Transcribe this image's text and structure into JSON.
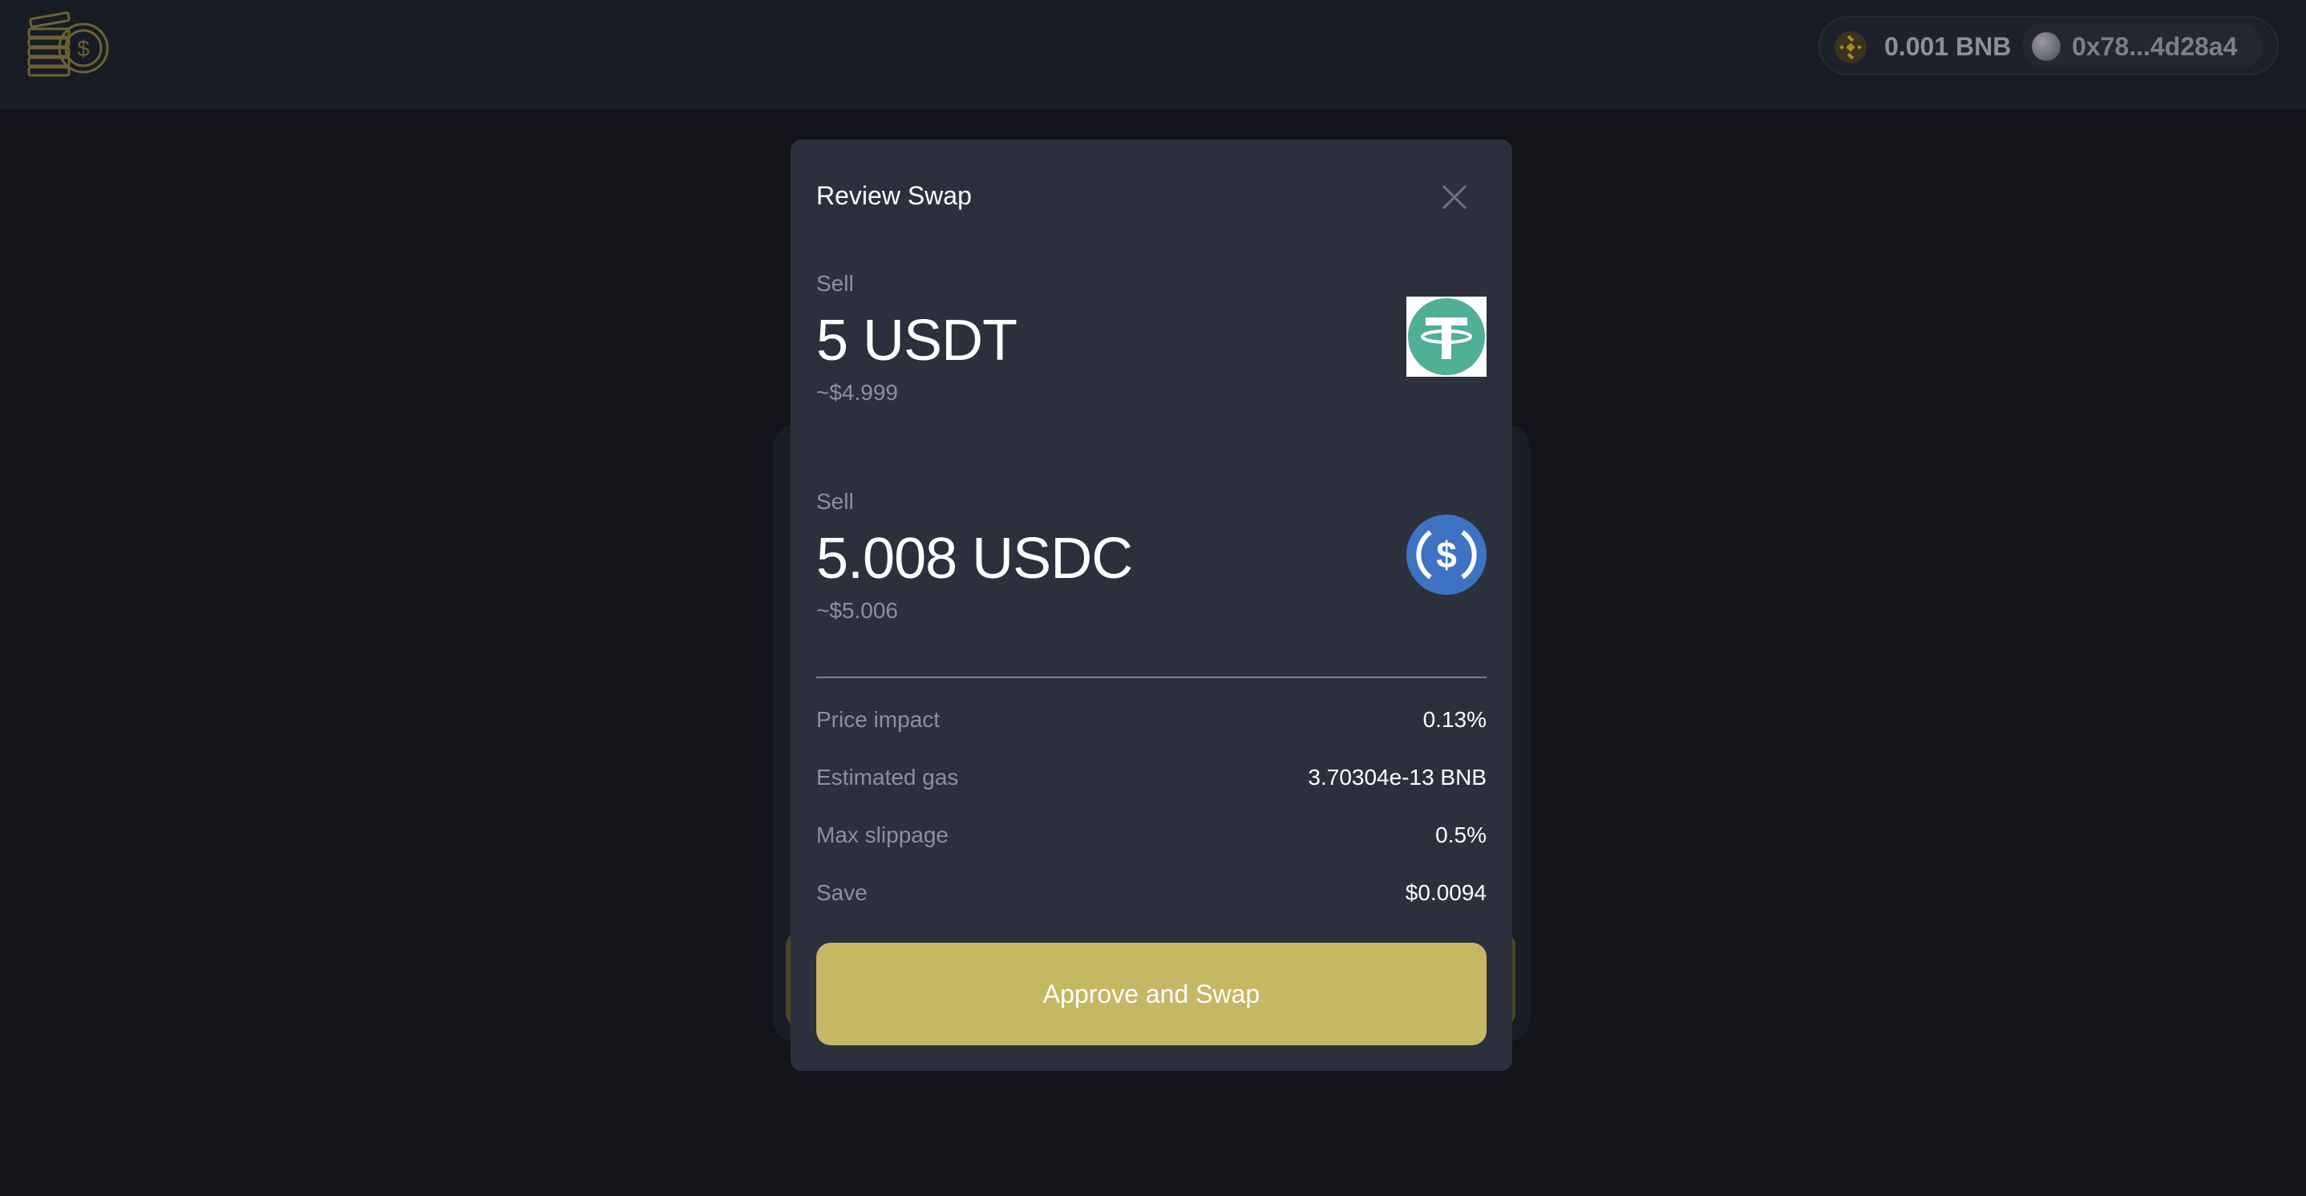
{
  "header": {
    "bnb_balance": "0.001 BNB",
    "wallet_address": "0x78...4d28a4"
  },
  "modal": {
    "title": "Review Swap",
    "sell": {
      "label": "Sell",
      "amount": "5 USDT",
      "usd": "~$4.999",
      "token_icon": "usdt-icon"
    },
    "buy": {
      "label": "Sell",
      "amount": "5.008 USDC",
      "usd": "~$5.006",
      "token_icon": "usdc-icon"
    },
    "details": [
      {
        "label": "Price impact",
        "value": "0.13%"
      },
      {
        "label": "Estimated gas",
        "value": "3.70304e-13 BNB"
      },
      {
        "label": "Max slippage",
        "value": "0.5%"
      },
      {
        "label": "Save",
        "value": "$0.0094"
      }
    ],
    "approve_label": "Approve and Swap"
  },
  "colors": {
    "accent": "#c5b865",
    "modal_bg": "#2c303d",
    "page_bg": "#12141a",
    "usdt_green": "#50af95",
    "usdc_blue": "#3e73c4"
  }
}
